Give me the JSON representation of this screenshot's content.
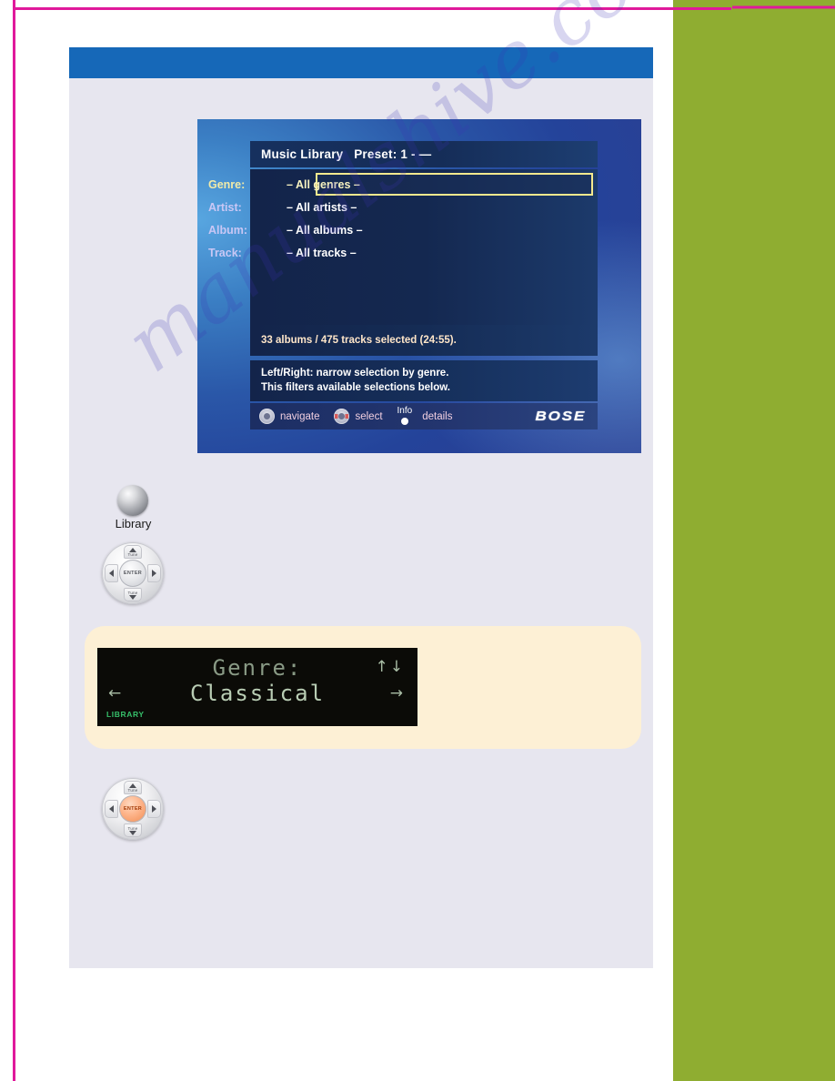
{
  "page": {
    "accent_magenta": "#e0199b",
    "accent_green": "#8fad31",
    "header_blue": "#1668b8",
    "panel_lavender": "#e7e6ef",
    "watermark_text": "manualshive.com"
  },
  "tv_screen": {
    "title": "Music Library   Preset: 1 - —",
    "fields": [
      {
        "label": "Genre:",
        "value": "– All genres –",
        "highlighted": true
      },
      {
        "label": "Artist:",
        "value": "– All artists –",
        "highlighted": false
      },
      {
        "label": "Album:",
        "value": "– All albums –",
        "highlighted": false
      },
      {
        "label": "Track:",
        "value": "– All tracks –",
        "highlighted": false
      }
    ],
    "status": "33 albums / 475 tracks selected (24:55).",
    "help_line_1": "Left/Right: narrow selection by genre.",
    "help_line_2": "This filters available selections below.",
    "footer": {
      "navigate_label": "navigate",
      "select_label": "select",
      "info_label": "Info",
      "details_label": "details",
      "brand": "BOSE"
    },
    "highlight_border_color": "#f5e98e"
  },
  "controls": {
    "library_button_label": "Library",
    "navpad_top_label": "Tune",
    "navpad_bottom_label": "Tune",
    "navpad_center_label": "ENTER",
    "navpad_active_center_label": "ENTER",
    "active_center_color": "#f08a4f"
  },
  "device_lcd": {
    "line_1": "Genre:",
    "line_2": "Classical",
    "arrow_up": "↑",
    "arrow_down": "↓",
    "arrow_right": "→",
    "arrow_left": "←",
    "source_indicator": "LIBRARY",
    "indicator_color": "#36c06a"
  }
}
